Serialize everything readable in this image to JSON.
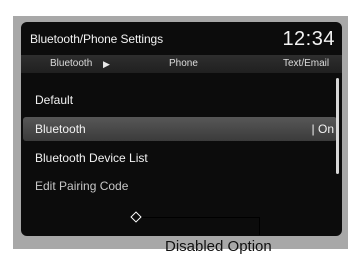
{
  "header": {
    "title": "Bluetooth/Phone Settings",
    "clock": "12:34"
  },
  "tabs": [
    {
      "label": "Bluetooth"
    },
    {
      "label": "Phone"
    },
    {
      "label": "Text/Email"
    }
  ],
  "menu": {
    "items": [
      {
        "label": "Default"
      },
      {
        "label": "Bluetooth",
        "value": "| On"
      },
      {
        "label": "Bluetooth Device List"
      },
      {
        "label": "Edit Pairing Code"
      }
    ]
  },
  "callout": {
    "label": "Disabled Option"
  }
}
